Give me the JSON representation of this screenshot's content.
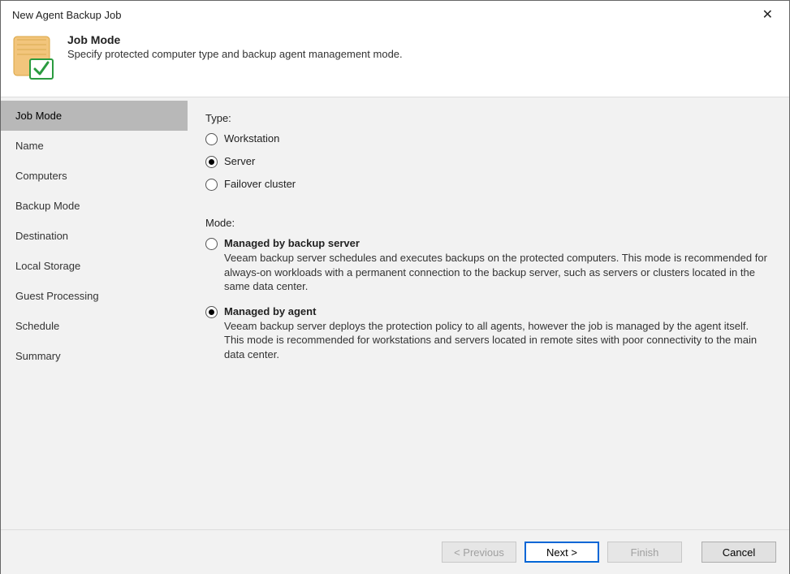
{
  "window": {
    "title": "New Agent Backup Job"
  },
  "header": {
    "title": "Job Mode",
    "subtitle": "Specify protected computer type and backup agent management mode."
  },
  "sidebar": {
    "steps": [
      {
        "label": "Job Mode",
        "active": true
      },
      {
        "label": "Name",
        "active": false
      },
      {
        "label": "Computers",
        "active": false
      },
      {
        "label": "Backup Mode",
        "active": false
      },
      {
        "label": "Destination",
        "active": false
      },
      {
        "label": "Local Storage",
        "active": false
      },
      {
        "label": "Guest Processing",
        "active": false
      },
      {
        "label": "Schedule",
        "active": false
      },
      {
        "label": "Summary",
        "active": false
      }
    ]
  },
  "content": {
    "type_label": "Type:",
    "type_options": [
      {
        "label": "Workstation",
        "checked": false
      },
      {
        "label": "Server",
        "checked": true
      },
      {
        "label": "Failover cluster",
        "checked": false
      }
    ],
    "mode_label": "Mode:",
    "mode_options": [
      {
        "label": "Managed by backup server",
        "desc": "Veeam backup server schedules and executes backups on the protected computers. This mode is recommended for always-on workloads with a permanent connection to the backup server, such as servers or clusters located in the same data center.",
        "checked": false
      },
      {
        "label": "Managed by agent",
        "desc": "Veeam backup server deploys the protection policy to all agents, however the job is managed by the agent itself. This mode is recommended for workstations and servers located in remote sites with poor connectivity to the main data center.",
        "checked": true
      }
    ]
  },
  "footer": {
    "previous": "< Previous",
    "next": "Next >",
    "finish": "Finish",
    "cancel": "Cancel"
  }
}
